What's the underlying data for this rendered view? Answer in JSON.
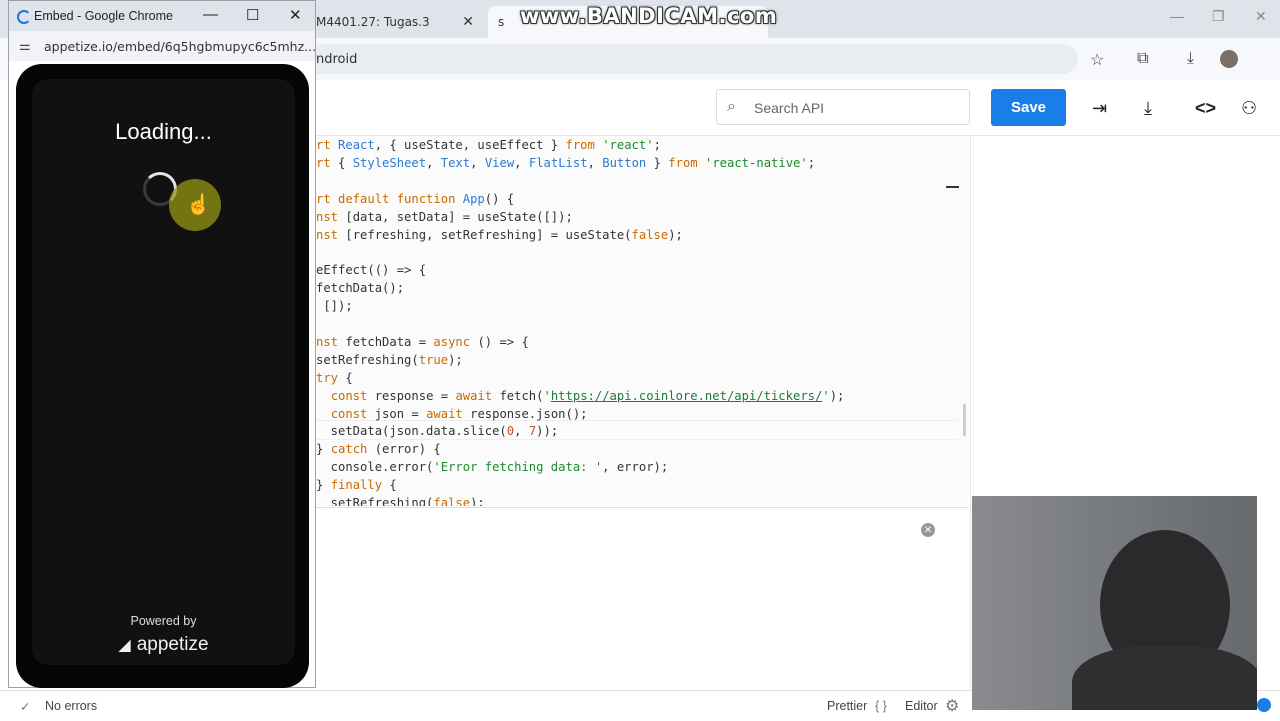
{
  "browser": {
    "tabs": [
      {
        "label": "M4401.27: Tugas.3",
        "close": "✕"
      },
      {
        "label": "s",
        "close": ""
      }
    ],
    "watermark": "www.BANDICAM.com",
    "address_suffix": "ndroid",
    "window_controls": [
      "—",
      "❐",
      "✕"
    ]
  },
  "app": {
    "search_placeholder": "Search API",
    "save_label": "Save",
    "code_lines": [
      [
        {
          "t": "rt ",
          "c": "k"
        },
        {
          "t": "React",
          "c": "f"
        },
        {
          "t": ", { useState, useEffect } ",
          "c": ""
        },
        {
          "t": "from",
          "c": "k"
        },
        {
          "t": " ",
          "c": ""
        },
        {
          "t": "'react'",
          "c": "s"
        },
        {
          "t": ";",
          "c": ""
        }
      ],
      [
        {
          "t": "rt ",
          "c": "k"
        },
        {
          "t": "{ ",
          "c": ""
        },
        {
          "t": "StyleSheet",
          "c": "f"
        },
        {
          "t": ", ",
          "c": ""
        },
        {
          "t": "Text",
          "c": "f"
        },
        {
          "t": ", ",
          "c": ""
        },
        {
          "t": "View",
          "c": "f"
        },
        {
          "t": ", ",
          "c": ""
        },
        {
          "t": "FlatList",
          "c": "f"
        },
        {
          "t": ", ",
          "c": ""
        },
        {
          "t": "Button",
          "c": "f"
        },
        {
          "t": " } ",
          "c": ""
        },
        {
          "t": "from",
          "c": "k"
        },
        {
          "t": " ",
          "c": ""
        },
        {
          "t": "'react-native'",
          "c": "s"
        },
        {
          "t": ";",
          "c": ""
        }
      ],
      [],
      [
        {
          "t": "rt default function ",
          "c": "k"
        },
        {
          "t": "App",
          "c": "f"
        },
        {
          "t": "() {",
          "c": ""
        }
      ],
      [
        {
          "t": "nst ",
          "c": "k"
        },
        {
          "t": "[data, setData] = useState([]);",
          "c": ""
        }
      ],
      [
        {
          "t": "nst ",
          "c": "k"
        },
        {
          "t": "[refreshing, setRefreshing] = useState(",
          "c": ""
        },
        {
          "t": "false",
          "c": "k"
        },
        {
          "t": ");",
          "c": ""
        }
      ],
      [],
      [
        {
          "t": "eEffect(() => {",
          "c": ""
        }
      ],
      [
        {
          "t": "fetchData();",
          "c": ""
        }
      ],
      [
        {
          "t": " []);",
          "c": ""
        }
      ],
      [],
      [
        {
          "t": "nst ",
          "c": "k"
        },
        {
          "t": "fetchData = ",
          "c": ""
        },
        {
          "t": "async",
          "c": "k"
        },
        {
          "t": " () => {",
          "c": ""
        }
      ],
      [
        {
          "t": "setRefreshing(",
          "c": ""
        },
        {
          "t": "true",
          "c": "k"
        },
        {
          "t": ");",
          "c": ""
        }
      ],
      [
        {
          "t": "try",
          "c": "k"
        },
        {
          "t": " {",
          "c": ""
        }
      ],
      [
        {
          "t": "  ",
          "c": ""
        },
        {
          "t": "const",
          "c": "k"
        },
        {
          "t": " response = ",
          "c": ""
        },
        {
          "t": "await",
          "c": "k"
        },
        {
          "t": " fetch(",
          "c": ""
        },
        {
          "t": "'",
          "c": "s"
        },
        {
          "t": "https://api.coinlore.net/api/tickers/",
          "c": "u"
        },
        {
          "t": "'",
          "c": "s"
        },
        {
          "t": ");",
          "c": ""
        }
      ],
      [
        {
          "t": "  ",
          "c": ""
        },
        {
          "t": "const",
          "c": "k"
        },
        {
          "t": " json = ",
          "c": ""
        },
        {
          "t": "await",
          "c": "k"
        },
        {
          "t": " response.json();",
          "c": ""
        }
      ],
      [
        {
          "t": "  setData(json.data.slice(",
          "c": ""
        },
        {
          "t": "0",
          "c": "n"
        },
        {
          "t": ", ",
          "c": ""
        },
        {
          "t": "7",
          "c": "n"
        },
        {
          "t": "));",
          "c": ""
        }
      ],
      [
        {
          "t": "} ",
          "c": ""
        },
        {
          "t": "catch",
          "c": "k"
        },
        {
          "t": " (error) {",
          "c": ""
        }
      ],
      [
        {
          "t": "  console.error(",
          "c": ""
        },
        {
          "t": "'Error fetching data: '",
          "c": "s"
        },
        {
          "t": ", error);",
          "c": ""
        }
      ],
      [
        {
          "t": "} ",
          "c": ""
        },
        {
          "t": "finally",
          "c": "k"
        },
        {
          "t": " {",
          "c": ""
        }
      ],
      [
        {
          "t": "  setRefreshing(",
          "c": ""
        },
        {
          "t": "false",
          "c": "k"
        },
        {
          "t": ");",
          "c": ""
        }
      ]
    ],
    "status": {
      "errors": "No errors",
      "prettier": "Prettier",
      "editor": "Editor"
    }
  },
  "popup": {
    "title": "Embed - Google Chrome",
    "url": "appetize.io/embed/6q5hgbmupyc6c5mhz...",
    "loading_text": "Loading...",
    "powered_by": "Powered by",
    "brand": "appetize"
  }
}
